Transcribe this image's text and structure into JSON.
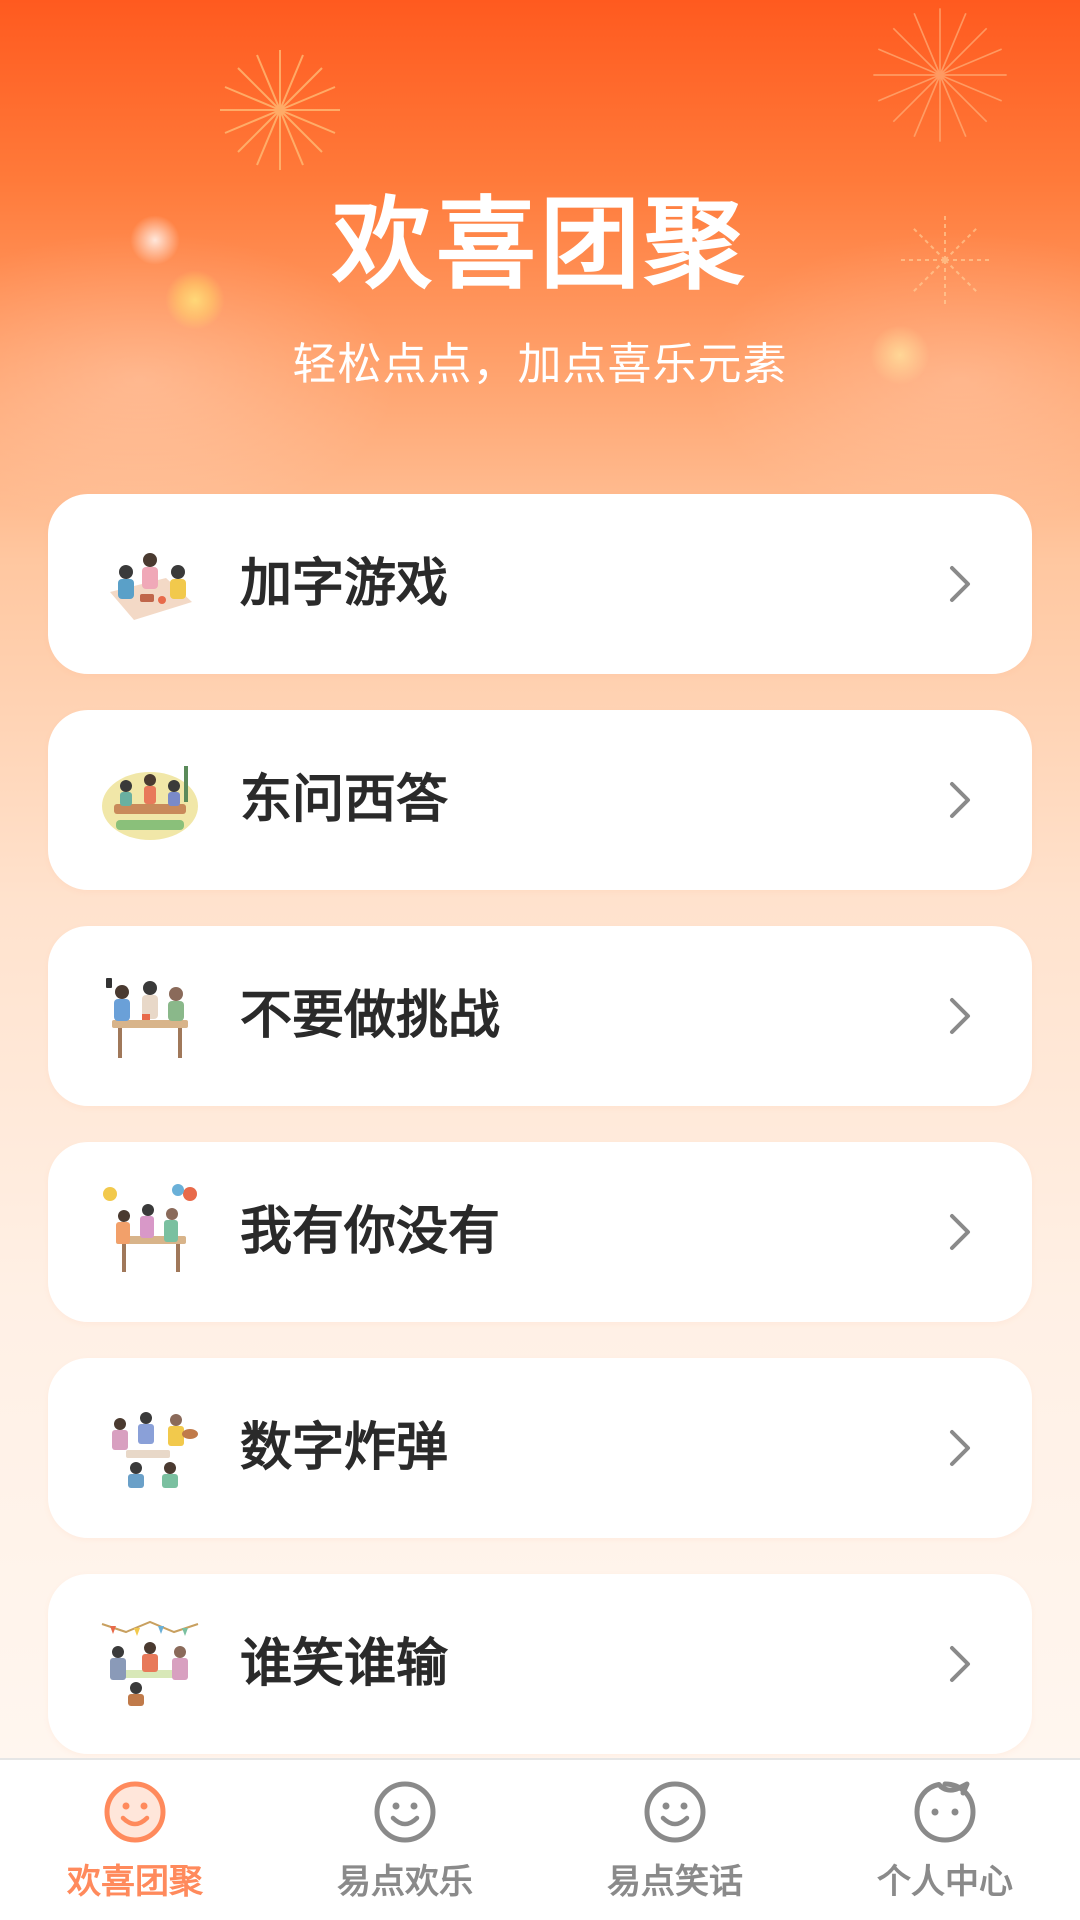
{
  "header": {
    "title": "欢喜团聚",
    "subtitle": "轻松点点，加点喜乐元素"
  },
  "games": [
    {
      "label": "加字游戏",
      "icon": "family-picnic-illustration"
    },
    {
      "label": "东问西答",
      "icon": "family-dinner-table-illustration"
    },
    {
      "label": "不要做挑战",
      "icon": "family-selfie-illustration"
    },
    {
      "label": "我有你没有",
      "icon": "family-party-balloons-illustration"
    },
    {
      "label": "数字炸弹",
      "icon": "family-music-gathering-illustration"
    },
    {
      "label": "谁笑谁输",
      "icon": "family-party-bunting-illustration"
    }
  ],
  "tabbar": {
    "tabs": [
      {
        "label": "欢喜团聚",
        "icon": "smiley-icon",
        "active": true
      },
      {
        "label": "易点欢乐",
        "icon": "smiley-icon",
        "active": false
      },
      {
        "label": "易点笑话",
        "icon": "smiley-icon",
        "active": false
      },
      {
        "label": "个人中心",
        "icon": "profile-face-icon",
        "active": false
      }
    ]
  },
  "colors": {
    "accent": "#ff7a3a",
    "tab_active": "#ff8a5c",
    "tab_inactive": "#8a8a8a",
    "card_text": "#2a2a2a",
    "chevron": "#8a8a8a"
  }
}
